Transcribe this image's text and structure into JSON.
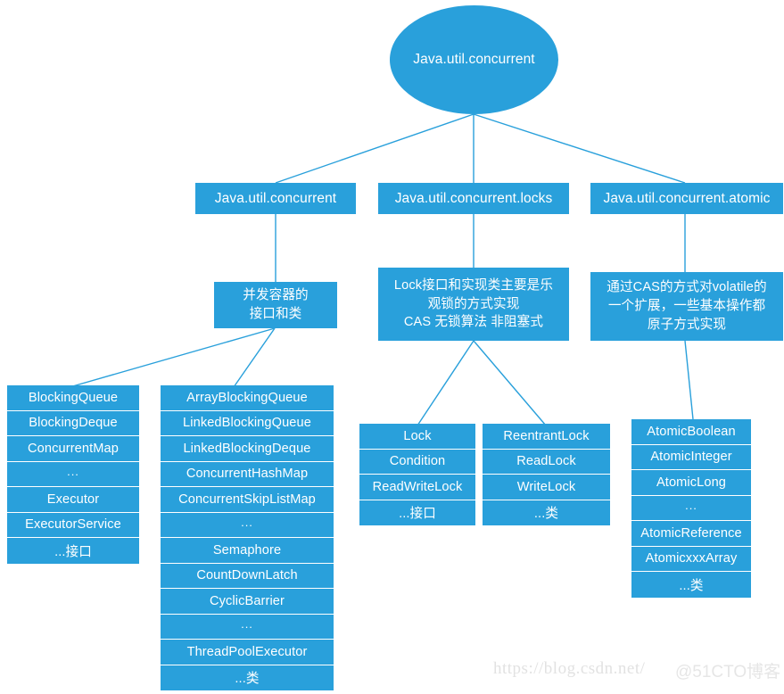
{
  "diagram": {
    "root": {
      "label": "Java.util.concurrent",
      "shape": "ellipse"
    },
    "packages": [
      {
        "id": "concurrent",
        "label": "Java.util.concurrent"
      },
      {
        "id": "locks",
        "label": "Java.util.concurrent.locks"
      },
      {
        "id": "atomic",
        "label": "Java.util.concurrent.atomic"
      }
    ],
    "descriptions": [
      {
        "id": "desc-concurrent",
        "text": "并发容器的\n接口和类"
      },
      {
        "id": "desc-locks",
        "text": "Lock接口和实现类主要是乐\n观锁的方式实现\nCAS 无锁算法 非阻塞式"
      },
      {
        "id": "desc-atomic",
        "text": "通过CAS的方式对volatile的\n一个扩展，一些基本操作都\n原子方式实现"
      }
    ],
    "leaf_groups": [
      {
        "id": "concurrent-interfaces",
        "items": [
          "BlockingQueue",
          "BlockingDeque",
          "ConcurrentMap",
          "...",
          "Executor",
          "ExecutorService",
          "...接口"
        ]
      },
      {
        "id": "concurrent-classes",
        "items": [
          "ArrayBlockingQueue",
          "LinkedBlockingQueue",
          "LinkedBlockingDeque",
          "ConcurrentHashMap",
          "ConcurrentSkipListMap",
          "...",
          "Semaphore",
          "CountDownLatch",
          "CyclicBarrier",
          "...",
          "ThreadPoolExecutor",
          "...类"
        ]
      },
      {
        "id": "locks-interfaces",
        "items": [
          "Lock",
          "Condition",
          "ReadWriteLock",
          "...接口"
        ]
      },
      {
        "id": "locks-classes",
        "items": [
          "ReentrantLock",
          "ReadLock",
          "WriteLock",
          "...类"
        ]
      },
      {
        "id": "atomic-classes",
        "items": [
          "AtomicBoolean",
          "AtomicInteger",
          "AtomicLong",
          "...",
          "AtomicReference",
          "AtomicxxxArray",
          "...类"
        ]
      }
    ],
    "colors": {
      "node_fill": "#29a0db",
      "node_text": "#ffffff",
      "edge_stroke": "#29a0db",
      "background": "#ffffff"
    }
  },
  "watermark": {
    "url": "https://blog.csdn.net/",
    "handle": "@51CTO博客"
  }
}
